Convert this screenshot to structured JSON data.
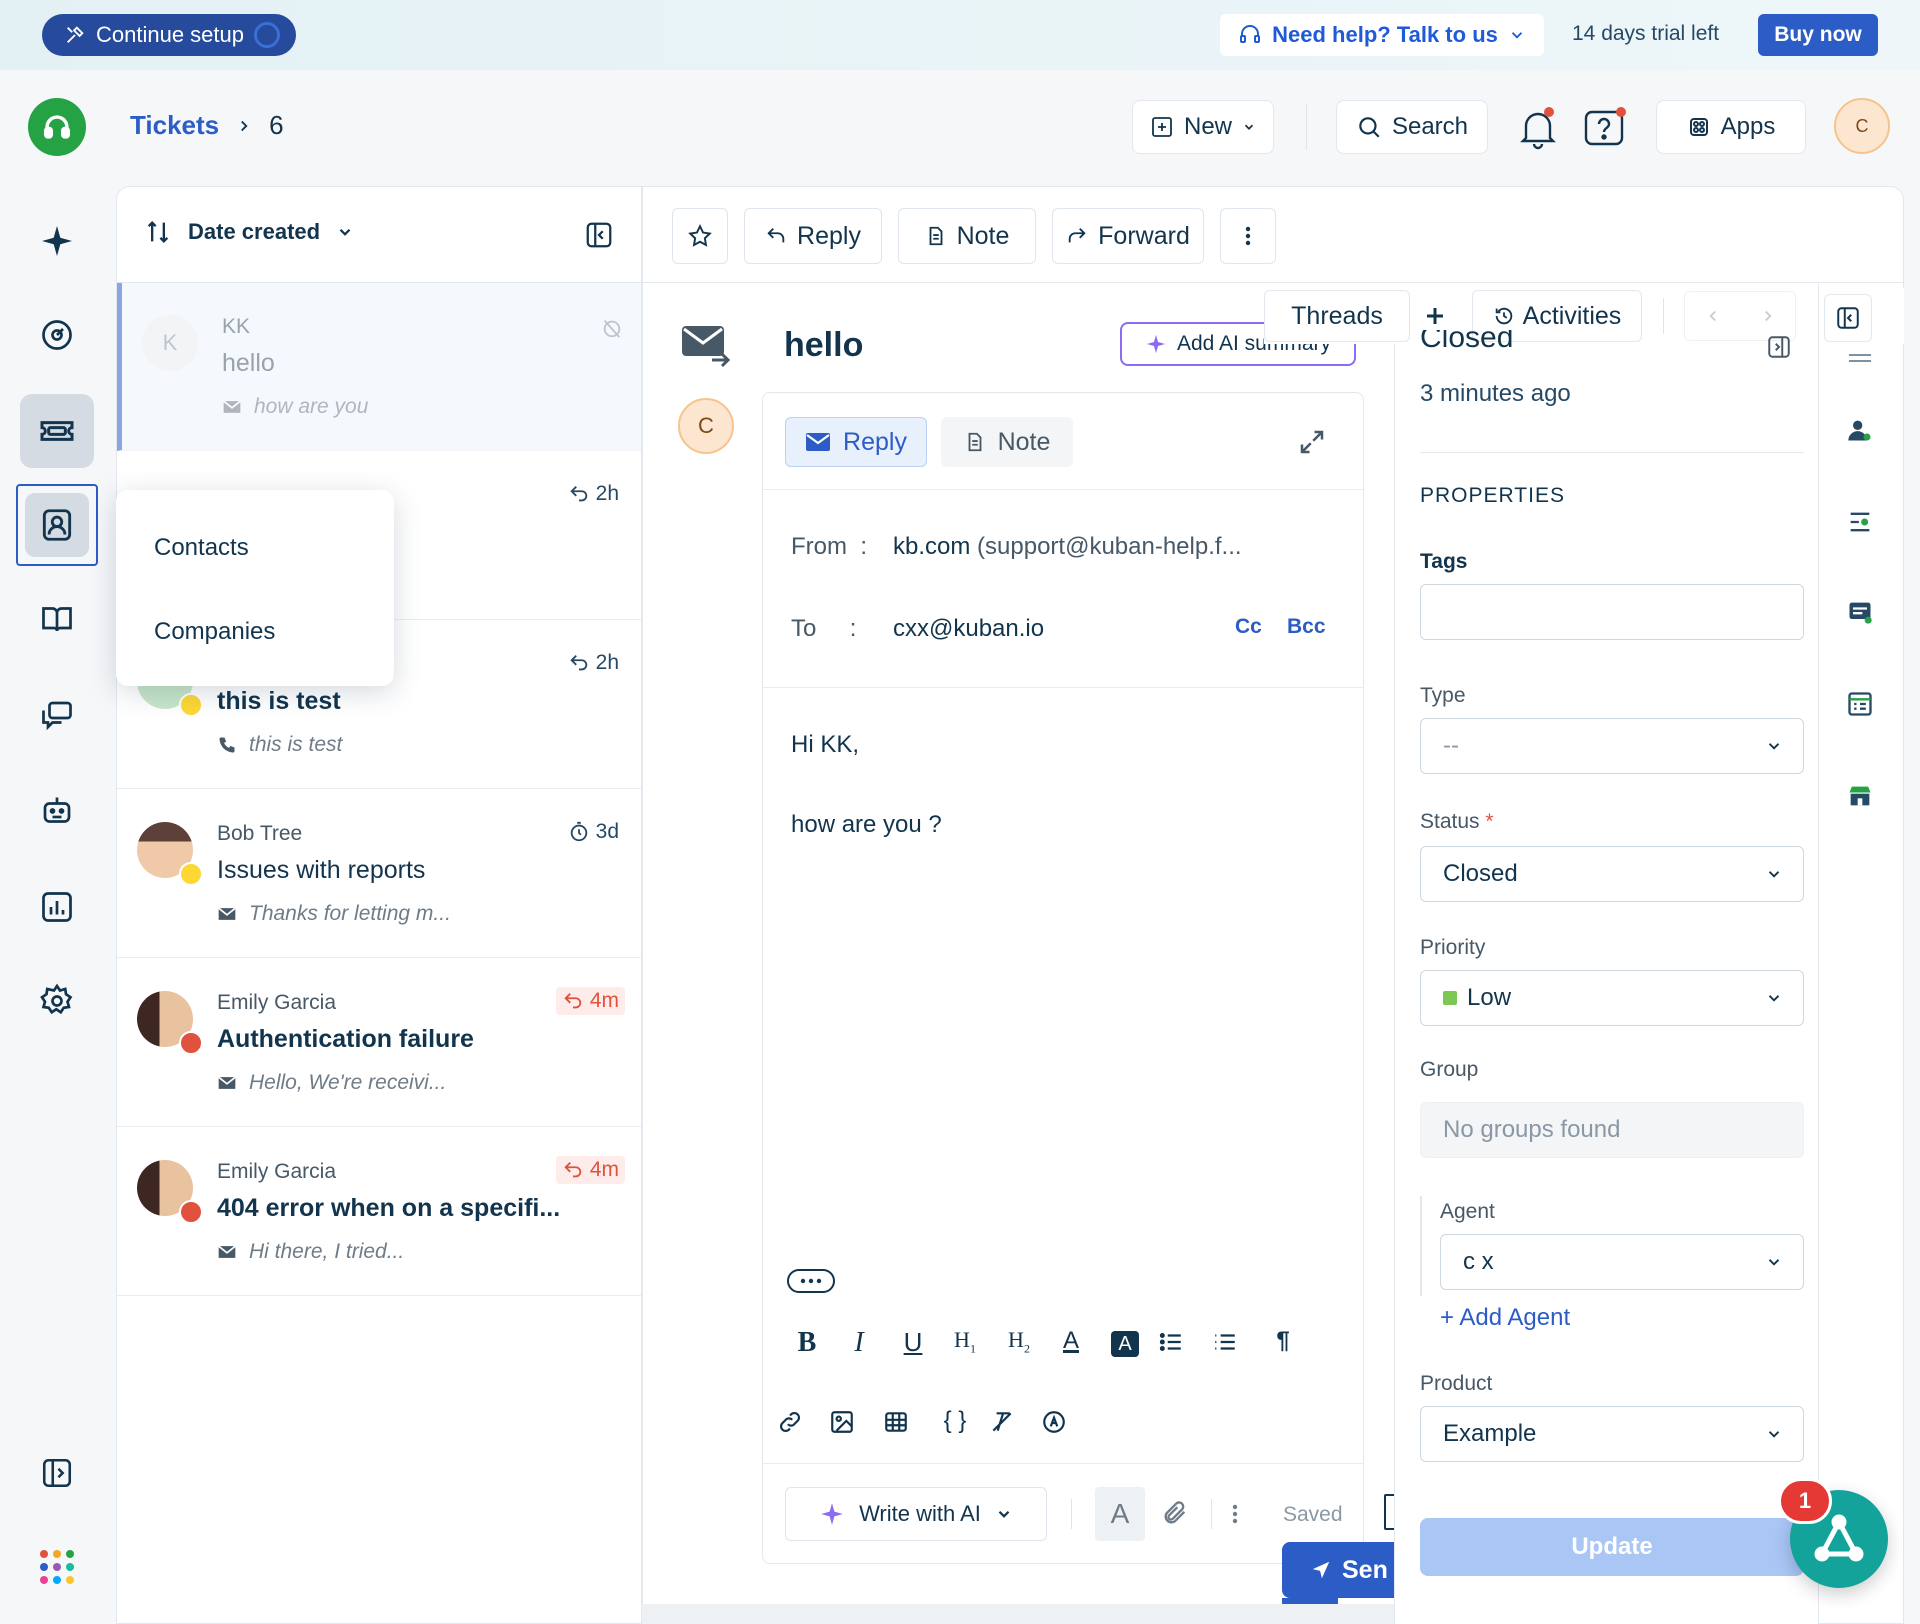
{
  "banner": {
    "setup_label": "Continue setup",
    "help_label": "Need help? Talk to us",
    "trial_text": "14 days trial left",
    "buy_label": "Buy now"
  },
  "header": {
    "crumb_root": "Tickets",
    "crumb_id": "6",
    "new_label": "New",
    "search_label": "Search",
    "apps_label": "Apps",
    "avatar_initial": "C"
  },
  "list": {
    "sort_label": "Date created",
    "tickets": [
      {
        "initial": "K",
        "who": "KK",
        "subject": "hello",
        "preview": "how are you",
        "time": ""
      },
      {
        "initial": "",
        "who": "",
        "subject": "",
        "preview": "",
        "time": "2h"
      },
      {
        "initial": "",
        "who": "",
        "subject": "this is test",
        "preview": "this is test",
        "time": "2h"
      },
      {
        "initial": "",
        "who": "Bob Tree",
        "subject": "Issues with reports",
        "preview": "Thanks for letting m...",
        "time": "3d"
      },
      {
        "initial": "",
        "who": "Emily Garcia",
        "subject": "Authentication failure",
        "preview": "Hello, We're receivi...",
        "time": "4m"
      },
      {
        "initial": "",
        "who": "Emily Garcia",
        "subject": "404 error when on a specifi...",
        "preview": "Hi there, I tried...",
        "time": "4m"
      }
    ]
  },
  "popup": {
    "items": [
      "Contacts",
      "Companies"
    ]
  },
  "toolbar": {
    "reply_label": "Reply",
    "note_label": "Note",
    "forward_label": "Forward"
  },
  "conversation": {
    "subject": "hello",
    "ai_summary_label": "Add AI summary",
    "threads_label": "Threads",
    "activities_label": "Activities",
    "sender_initial": "C"
  },
  "composer": {
    "tab_reply": "Reply",
    "tab_note": "Note",
    "from_label": "From",
    "from_name": "kb.com",
    "from_email": "(support@kuban-help.f...",
    "to_label": "To",
    "to_value": "cxx@kuban.io",
    "cc_label": "Cc",
    "bcc_label": "Bcc",
    "body_line1": "Hi KK,",
    "body_line2": "how are you ?",
    "write_ai_label": "Write with AI",
    "saved_label": "Saved",
    "send_label": "Sen"
  },
  "properties": {
    "status_title": "Closed",
    "status_time": "3 minutes ago",
    "section_title": "PROPERTIES",
    "tags_label": "Tags",
    "type_label": "Type",
    "type_value": "--",
    "status_label": "Status",
    "status_value": "Closed",
    "priority_label": "Priority",
    "priority_value": "Low",
    "priority_color": "#7dc855",
    "group_label": "Group",
    "group_placeholder": "No groups found",
    "agent_label": "Agent",
    "agent_value": "c x",
    "add_agent_label": "+ Add Agent",
    "product_label": "Product",
    "product_value": "Example",
    "update_label": "Update"
  },
  "widget": {
    "badge_count": "1"
  },
  "colors": {
    "accent": "#2c5cc5",
    "brand_green": "#25a244",
    "danger": "#e0523d"
  }
}
